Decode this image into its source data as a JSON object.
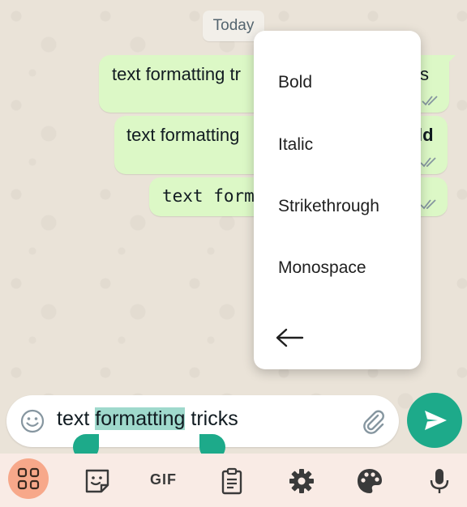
{
  "chat": {
    "date_label": "Today",
    "messages": [
      {
        "visible_text": "text formatting tr",
        "trailing_text": "s",
        "status": "read"
      },
      {
        "visible_text": "text formatting",
        "trailing_text": "ld",
        "status": "read"
      },
      {
        "visible_text": "text forma",
        "status": "read"
      }
    ]
  },
  "format_menu": {
    "items": [
      "Bold",
      "Italic",
      "Strikethrough",
      "Monospace"
    ],
    "back_icon": "arrow-left-icon"
  },
  "composer": {
    "text_before": "text ",
    "text_selected": "formatting",
    "text_after": " tricks",
    "emoji_icon": "emoji-icon",
    "attach_icon": "paperclip-icon",
    "send_icon": "send-icon"
  },
  "keyboard_toolbar": {
    "gif_label": "GIF",
    "icons": [
      "apps-grid-icon",
      "sticker-icon",
      "clipboard-icon",
      "settings-gear-icon",
      "palette-icon",
      "microphone-icon"
    ]
  },
  "colors": {
    "bubble": "#dcf8c6",
    "accent": "#1daa8a",
    "selection": "#9fd9cc",
    "keyboard_bar": "#f9ebe5"
  }
}
